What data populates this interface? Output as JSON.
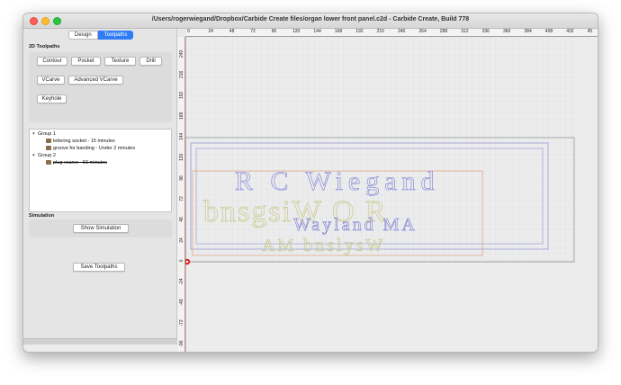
{
  "window": {
    "title": "/Users/rogerwiegand/Dropbox/Carbide Create files/organ lower front panel.c2d - Carbide Create, Build 778"
  },
  "tabs": [
    {
      "label": "Design"
    },
    {
      "label": "Toolpaths"
    }
  ],
  "toolpaths_section": {
    "label": "2D Toolpaths",
    "buttons": {
      "contour": "Contour",
      "pocket": "Pocket",
      "texture": "Texture",
      "drill": "Drill",
      "vcarve": "VCarve",
      "advanced_vcarve": "Advanced VCarve",
      "keyhole": "Keyhole"
    }
  },
  "tree": {
    "group1": {
      "label": "Group 1",
      "items": [
        "lettering socket - 15 minutes",
        "groove for banding - Under 2 minutes"
      ]
    },
    "group2": {
      "label": "Group 2",
      "items": [
        "plug vcarve - 56 minutes"
      ]
    }
  },
  "simulation": {
    "label": "Simulation",
    "show_button": "Show Simulation"
  },
  "save_button": "Save Toolpaths",
  "rulers": {
    "top": [
      "0",
      "24",
      "48",
      "72",
      "96",
      "120",
      "144",
      "168",
      "192",
      "216",
      "240",
      "264",
      "288",
      "312",
      "336",
      "360",
      "384",
      "408",
      "432",
      "45"
    ],
    "left": [
      "240",
      "216",
      "192",
      "168",
      "144",
      "120",
      "96",
      "72",
      "48",
      "24",
      "0",
      "-24",
      "-48",
      "-72",
      "-96"
    ]
  },
  "design": {
    "line1": "R C Wiegand",
    "line2": "Wayland MA",
    "mirror_line1": "bnsgsiW O R",
    "mirror_line2": "AM bnslysW"
  },
  "colors": {
    "accent": "#2f7cf6",
    "vector_blue": "#7b7bd6",
    "vector_olive": "#b9b97a",
    "stock_orange": "#e0a07a",
    "origin": "#e02020"
  }
}
